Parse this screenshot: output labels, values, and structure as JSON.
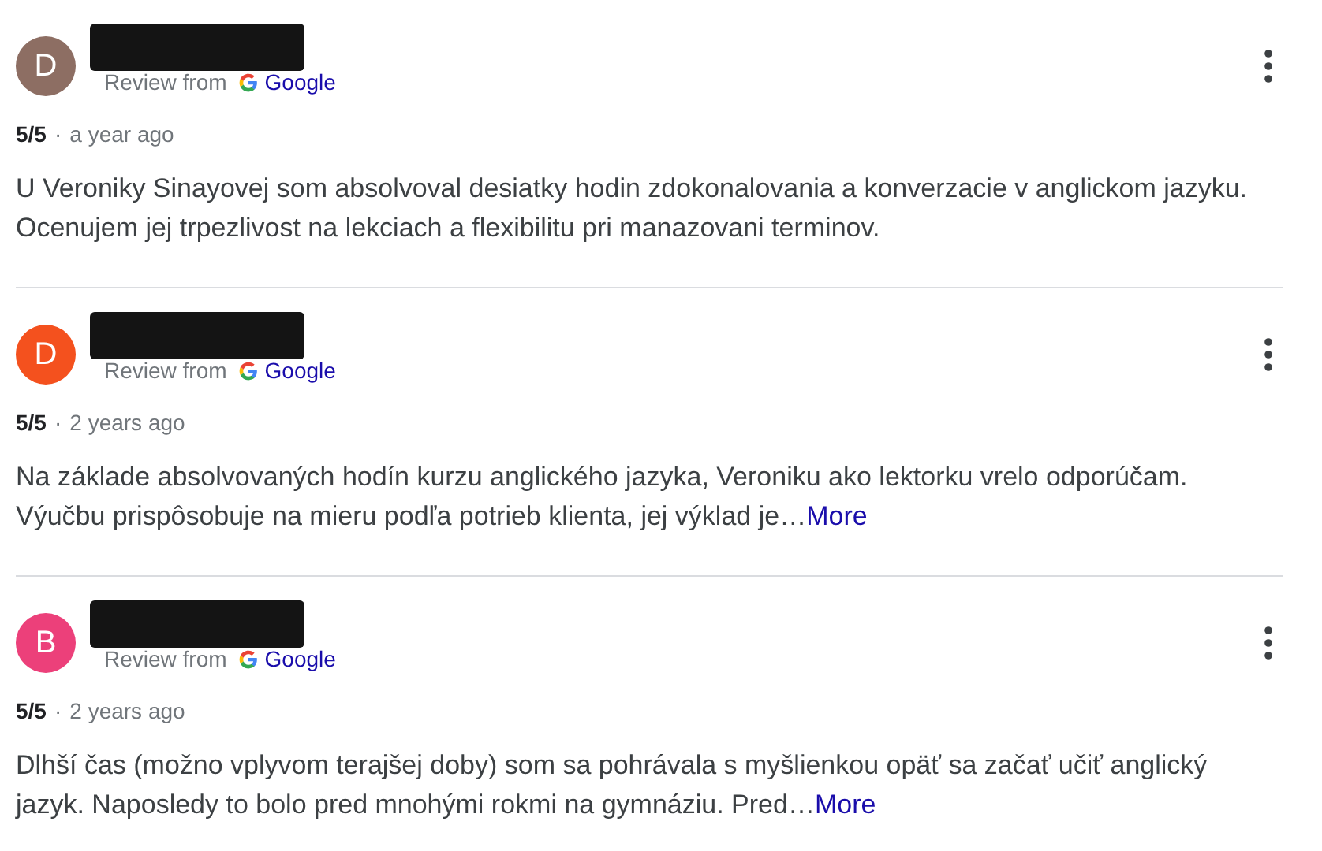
{
  "reviews": [
    {
      "avatar_letter": "D",
      "color": "#8d6e63",
      "source_label": "Review from",
      "source_name": "Google",
      "rating": "5/5",
      "separator": "·",
      "time": "a year ago",
      "text": "U Veroniky Sinayovej som absolvoval desiatky hodin zdokonalovania a konverzacie v anglickom jazyku. Ocenujem jej trpezlivost na lekciach a flexibilitu pri manazovani terminov."
    },
    {
      "avatar_letter": "D",
      "color": "#f4511e",
      "source_label": "Review from",
      "source_name": "Google",
      "rating": "5/5",
      "separator": "·",
      "time": "2 years ago",
      "text": "Na základe absolvovaných hodín kurzu anglického jazyka, Veroniku ako lektorku vrelo odporúčam. Výučbu prispôsobuje na mieru podľa potrieb klienta, jej výklad je…",
      "more": "More"
    },
    {
      "avatar_letter": "B",
      "color": "#ec407a",
      "source_label": "Review from",
      "source_name": "Google",
      "rating": "5/5",
      "separator": "·",
      "time": "2 years ago",
      "text": "Dlhší čas (možno vplyvom terajšej doby) som sa pohrávala s myšlienkou opäť sa začať učiť anglický jazyk. Naposledy to bolo pred mnohými rokmi na gymnáziu. Pred…",
      "more": "More"
    }
  ]
}
